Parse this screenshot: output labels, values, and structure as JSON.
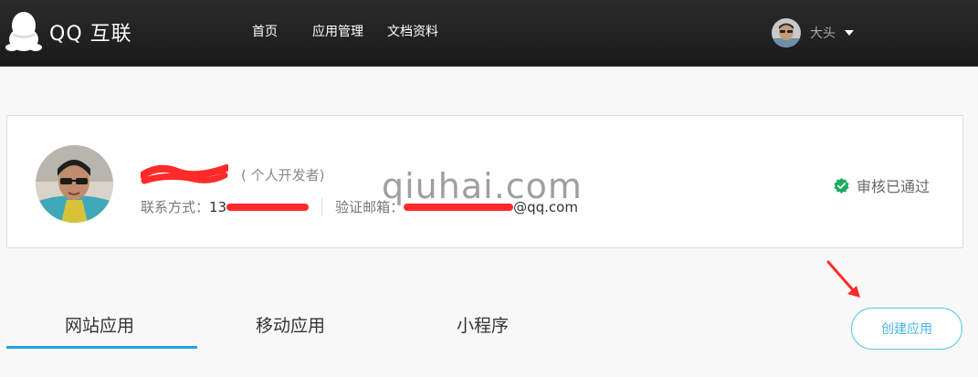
{
  "header": {
    "logo_text": "QQ 互联",
    "nav": [
      "首页",
      "应用管理",
      "文档资料"
    ],
    "user_name": "大头"
  },
  "profile": {
    "dev_type": "( 个人开发者)",
    "contact_label": "联系方式：",
    "contact_phone_prefix": "13",
    "email_label": "验证邮箱：",
    "email_suffix": "@qq.com",
    "status_text": "审核已通过"
  },
  "watermark": "qiuhai.com",
  "tabs": [
    "网站应用",
    "移动应用",
    "小程序"
  ],
  "create_button": "创建应用",
  "colors": {
    "header_bg": "#1f1f1f",
    "tab_active_underline": "#2a9fe0",
    "button_border": "#5cc6ec",
    "status_green": "#1aad5a",
    "redaction_red": "#ff2a2a"
  },
  "icons": {
    "logo": "qq-penguin-icon",
    "status": "check-badge-icon",
    "dropdown": "caret-down-icon"
  }
}
